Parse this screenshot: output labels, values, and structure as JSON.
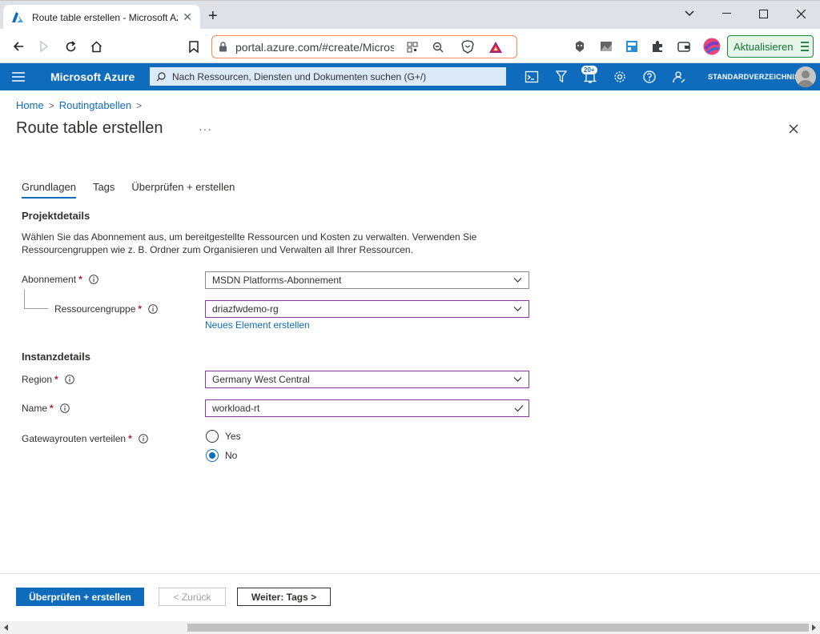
{
  "browser": {
    "tab_title": "Route table erstellen - Microsoft Azure",
    "address": "portal.azure.com/#create/Microsoft.RouteTable-ARM",
    "update_label": "Aktualisieren"
  },
  "azure": {
    "brand": "Microsoft Azure",
    "search_placeholder": "Nach Ressourcen, Diensten und Dokumenten suchen (G+/)",
    "notifications_badge": "20+",
    "directory": "STANDARDVERZEICHNIS"
  },
  "breadcrumb": [
    "Home",
    "Routingtabellen"
  ],
  "page": {
    "title": "Route table erstellen",
    "more": "···"
  },
  "tabs": [
    "Grundlagen",
    "Tags",
    "Überprüfen + erstellen"
  ],
  "project": {
    "title": "Projektdetails",
    "description": "Wählen Sie das Abonnement aus, um bereitgestellte Ressourcen und Kosten zu verwalten. Verwenden Sie Ressourcengruppen wie z. B. Ordner zum Organisieren und Verwalten all Ihrer Ressourcen.",
    "subscription_label": "Abonnement",
    "subscription_value": "MSDN Platforms-Abonnement",
    "rg_label": "Ressourcengruppe",
    "rg_value": "driazfwdemo-rg",
    "new_link": "Neues Element erstellen"
  },
  "instance": {
    "title": "Instanzdetails",
    "region_label": "Region",
    "region_value": "Germany West Central",
    "name_label": "Name",
    "name_value": "workload-rt",
    "gateway_label": "Gatewayrouten verteilen",
    "option_yes": "Yes",
    "option_no": "No",
    "selected": "No"
  },
  "footer": {
    "primary": "Überprüfen + erstellen",
    "back": "< Zurück",
    "next": "Weiter: Tags >"
  },
  "colors": {
    "azure_blue": "#0f6cbd",
    "required": "#a4262c",
    "valid_border": "#8b3aa8"
  },
  "icons": [
    "azure-favicon",
    "back-icon",
    "forward-icon",
    "reload-icon",
    "home-icon",
    "bookmark-icon",
    "lock-icon",
    "qr-icon",
    "zoom-icon",
    "brave-icon",
    "bat-icon",
    "extension-icon",
    "puzzle-icon",
    "wallet-icon",
    "profile-icon",
    "menu-icon",
    "search-icon",
    "cloud-shell-icon",
    "filter-icon",
    "bell-icon",
    "gear-icon",
    "help-icon",
    "feedback-icon",
    "close-icon",
    "chevron-down-icon",
    "info-icon",
    "check-icon"
  ]
}
